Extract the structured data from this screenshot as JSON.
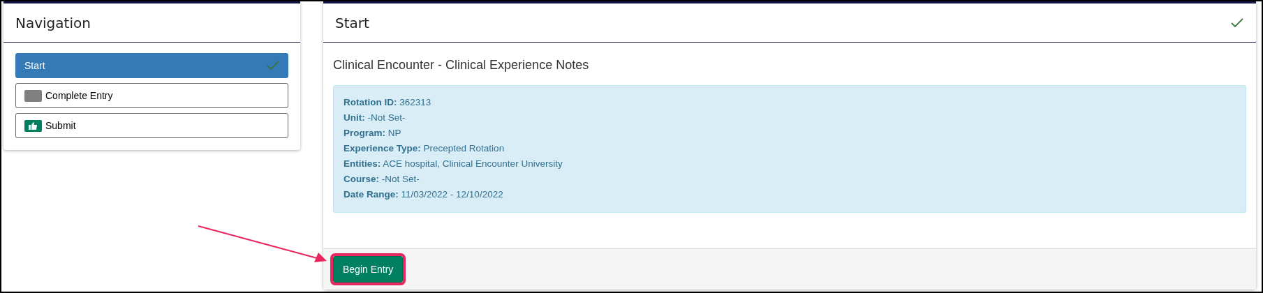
{
  "navigation": {
    "title": "Navigation",
    "items": [
      {
        "label": "Start",
        "selected": true,
        "kind": "done"
      },
      {
        "label": "Complete Entry",
        "selected": false,
        "kind": "pending"
      },
      {
        "label": "Submit",
        "selected": false,
        "kind": "submit"
      }
    ]
  },
  "panel": {
    "title": "Start",
    "complete": true,
    "heading": "Clinical Encounter - Clinical Experience Notes",
    "details": [
      {
        "label": "Rotation ID:",
        "value": "362313"
      },
      {
        "label": "Unit:",
        "value": "-Not Set-"
      },
      {
        "label": "Program:",
        "value": "NP"
      },
      {
        "label": "Experience Type:",
        "value": "Precepted Rotation"
      },
      {
        "label": "Entities:",
        "value": "ACE hospital, Clinical Encounter University"
      },
      {
        "label": "Course:",
        "value": "-Not Set-"
      },
      {
        "label": "Date Range:",
        "value": "11/03/2022 - 12/10/2022"
      }
    ],
    "button": {
      "label": "Begin Entry",
      "highlighted": true
    }
  }
}
